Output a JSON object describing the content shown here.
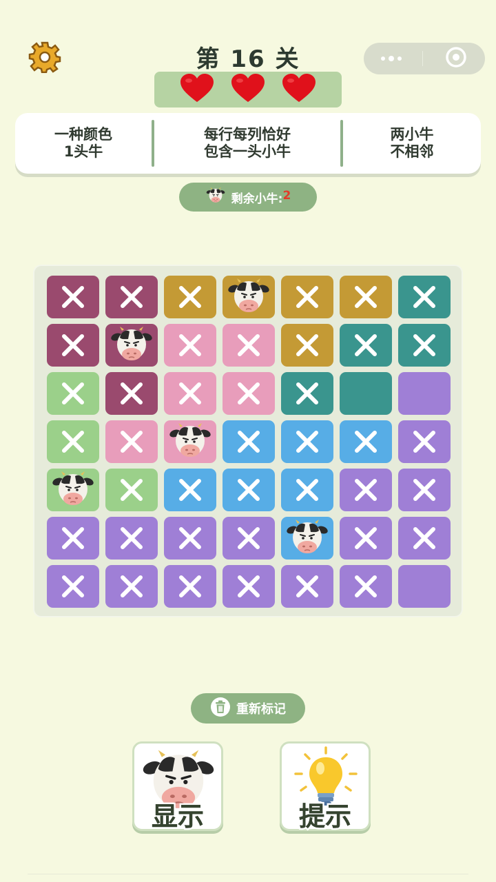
{
  "header": {
    "title": "第 16 关",
    "lives": 3
  },
  "rules": [
    {
      "line1": "一种颜色",
      "line2": "1头牛"
    },
    {
      "line1": "每行每列恰好",
      "line2": "包含一头小牛"
    },
    {
      "line1": "两小牛",
      "line2": "不相邻"
    }
  ],
  "remaining": {
    "label": "剩余小牛:",
    "count": "2"
  },
  "colors": {
    "maroon": "#9a4a6e",
    "mustard": "#c49a35",
    "teal": "#3a958e",
    "pink": "#e89dbb",
    "green": "#9bd08a",
    "blue": "#57ade6",
    "purple": "#9f7fd6"
  },
  "board": {
    "rows": [
      [
        {
          "c": "maroon",
          "s": "x"
        },
        {
          "c": "maroon",
          "s": "x"
        },
        {
          "c": "mustard",
          "s": "x"
        },
        {
          "c": "mustard",
          "s": "cow"
        },
        {
          "c": "mustard",
          "s": "x"
        },
        {
          "c": "mustard",
          "s": "x"
        },
        {
          "c": "teal",
          "s": "x"
        }
      ],
      [
        {
          "c": "maroon",
          "s": "x"
        },
        {
          "c": "maroon",
          "s": "cow"
        },
        {
          "c": "pink",
          "s": "x"
        },
        {
          "c": "pink",
          "s": "x"
        },
        {
          "c": "mustard",
          "s": "x"
        },
        {
          "c": "teal",
          "s": "x"
        },
        {
          "c": "teal",
          "s": "x"
        }
      ],
      [
        {
          "c": "green",
          "s": "x"
        },
        {
          "c": "maroon",
          "s": "x"
        },
        {
          "c": "pink",
          "s": "x"
        },
        {
          "c": "pink",
          "s": "x"
        },
        {
          "c": "teal",
          "s": "x"
        },
        {
          "c": "teal",
          "s": "empty"
        },
        {
          "c": "purple",
          "s": "empty"
        }
      ],
      [
        {
          "c": "green",
          "s": "x"
        },
        {
          "c": "pink",
          "s": "x"
        },
        {
          "c": "pink",
          "s": "cow"
        },
        {
          "c": "blue",
          "s": "x"
        },
        {
          "c": "blue",
          "s": "x"
        },
        {
          "c": "blue",
          "s": "x"
        },
        {
          "c": "purple",
          "s": "x"
        }
      ],
      [
        {
          "c": "green",
          "s": "cow"
        },
        {
          "c": "green",
          "s": "x"
        },
        {
          "c": "blue",
          "s": "x"
        },
        {
          "c": "blue",
          "s": "x"
        },
        {
          "c": "blue",
          "s": "x"
        },
        {
          "c": "purple",
          "s": "x"
        },
        {
          "c": "purple",
          "s": "x"
        }
      ],
      [
        {
          "c": "purple",
          "s": "x"
        },
        {
          "c": "purple",
          "s": "x"
        },
        {
          "c": "purple",
          "s": "x"
        },
        {
          "c": "purple",
          "s": "x"
        },
        {
          "c": "blue",
          "s": "cow"
        },
        {
          "c": "purple",
          "s": "x"
        },
        {
          "c": "purple",
          "s": "x"
        }
      ],
      [
        {
          "c": "purple",
          "s": "x"
        },
        {
          "c": "purple",
          "s": "x"
        },
        {
          "c": "purple",
          "s": "x"
        },
        {
          "c": "purple",
          "s": "x"
        },
        {
          "c": "purple",
          "s": "x"
        },
        {
          "c": "purple",
          "s": "x"
        },
        {
          "c": "purple",
          "s": "empty"
        }
      ]
    ]
  },
  "actions": {
    "reset_label": "重新标记",
    "show_label": "显示",
    "hint_label": "提示"
  }
}
